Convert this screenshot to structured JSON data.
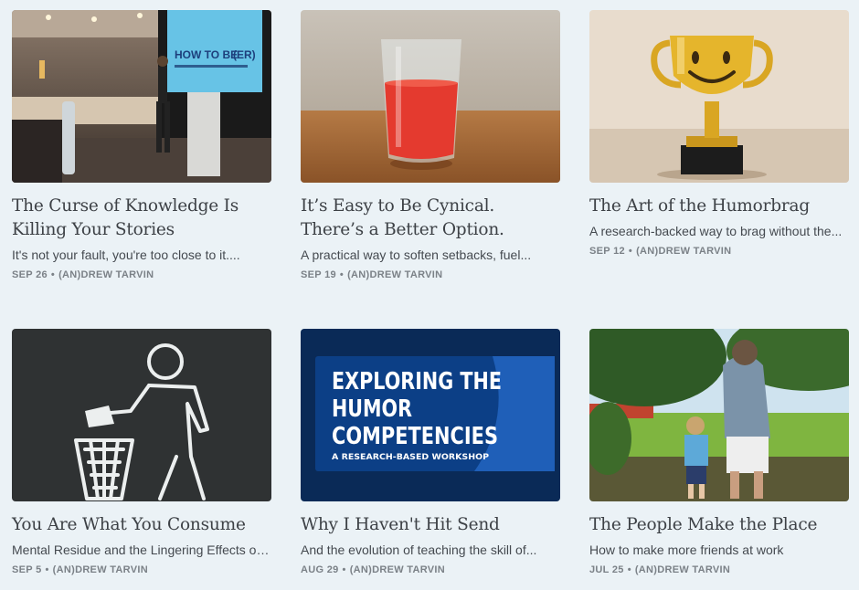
{
  "posts": [
    {
      "title": "The Curse of Knowledge Is Killing Your Stories",
      "subtitle": "It's not your fault, you're too close to it....",
      "date": "SEP 26",
      "author": "(AN)DREW TARVIN",
      "image": "speaker-on-stage-photo",
      "slide_text_1": "HOW TO BE",
      "slide_text_2": "(ER)"
    },
    {
      "title": "It’s Easy to Be Cynical. There’s a Better Option.",
      "subtitle": "A practical way to soften setbacks, fuel...",
      "date": "SEP 19",
      "author": "(AN)DREW TARVIN",
      "image": "glass-of-red-drink-photo"
    },
    {
      "title": "The Art of the Humorbrag",
      "subtitle": "A research-backed way to brag without the...",
      "date": "SEP 12",
      "author": "(AN)DREW TARVIN",
      "image": "smiling-trophy-photo"
    },
    {
      "title": "You Are What You Consume",
      "subtitle": "Mental Residue and the Lingering Effects on...",
      "date": "SEP 5",
      "author": "(AN)DREW TARVIN",
      "image": "trash-can-chalk-icon-photo"
    },
    {
      "title": "Why I Haven't Hit Send",
      "subtitle": "And the evolution of teaching the skill of...",
      "date": "AUG 29",
      "author": "(AN)DREW TARVIN",
      "image": "workshop-banner",
      "banner_line_1": "EXPLORING THE",
      "banner_line_2": "HUMOR",
      "banner_line_3": "COMPETENCIES",
      "banner_sub": "A RESEARCH-BASED WORKSHOP"
    },
    {
      "title": "The People Make the Place",
      "subtitle": "How to make more friends at work",
      "date": "JUL 25",
      "author": "(AN)DREW TARVIN",
      "image": "park-with-woman-and-child-photo"
    }
  ],
  "separator": "•",
  "colors": {
    "background": "#ebf2f6",
    "title": "#3d4146",
    "meta": "#7b8187",
    "banner_blue": "#0c3f86"
  }
}
